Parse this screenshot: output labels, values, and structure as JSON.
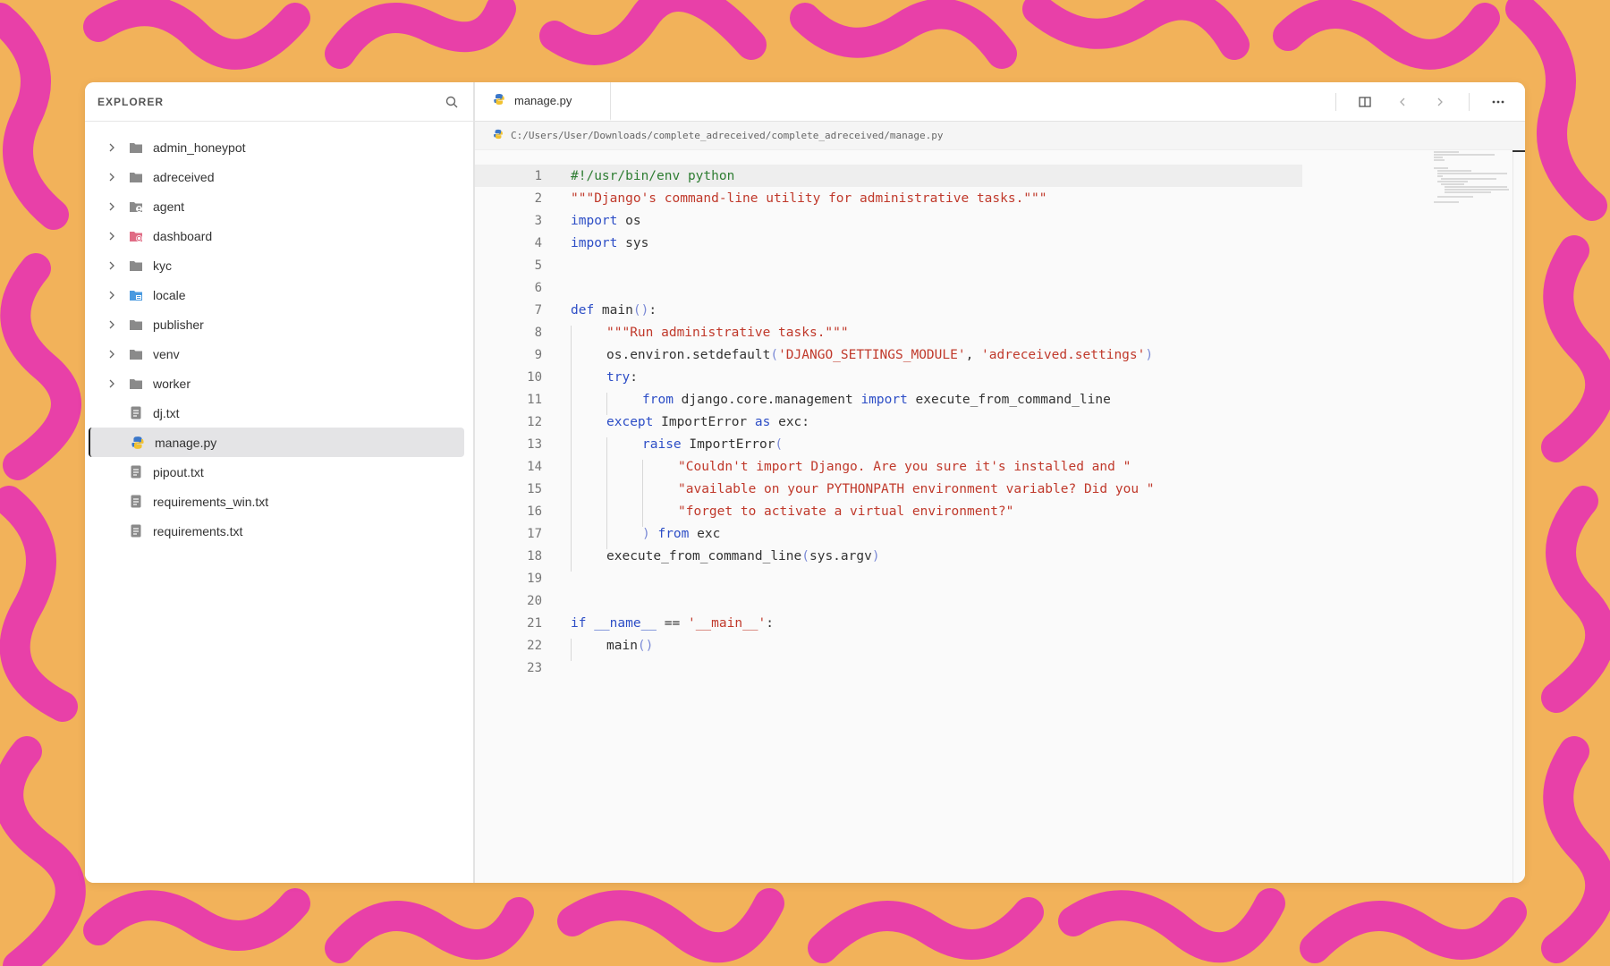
{
  "colors": {
    "background": "#f2b25a",
    "pattern": "#e840a8",
    "keyword": "#2d4ec6",
    "string": "#c0392b",
    "comment": "#2e7d32"
  },
  "sidebar": {
    "title": "EXPLORER",
    "search_icon": "search-icon",
    "items": [
      {
        "label": "admin_honeypot",
        "type": "folder",
        "icon": "folder-icon"
      },
      {
        "label": "adreceived",
        "type": "folder",
        "icon": "folder-icon"
      },
      {
        "label": "agent",
        "type": "folder",
        "icon": "folder-agent-icon"
      },
      {
        "label": "dashboard",
        "type": "folder",
        "icon": "folder-dashboard-icon"
      },
      {
        "label": "kyc",
        "type": "folder",
        "icon": "folder-icon"
      },
      {
        "label": "locale",
        "type": "folder",
        "icon": "folder-locale-icon"
      },
      {
        "label": "publisher",
        "type": "folder",
        "icon": "folder-icon"
      },
      {
        "label": "venv",
        "type": "folder",
        "icon": "folder-icon"
      },
      {
        "label": "worker",
        "type": "folder",
        "icon": "folder-icon"
      },
      {
        "label": "dj.txt",
        "type": "file",
        "icon": "text-file-icon"
      },
      {
        "label": "manage.py",
        "type": "file",
        "icon": "python-file-icon",
        "selected": true
      },
      {
        "label": "pipout.txt",
        "type": "file",
        "icon": "text-file-icon"
      },
      {
        "label": "requirements_win.txt",
        "type": "file",
        "icon": "text-file-icon"
      },
      {
        "label": "requirements.txt",
        "type": "file",
        "icon": "text-file-icon"
      }
    ]
  },
  "editor": {
    "tab_label": "manage.py",
    "breadcrumb": "C:/Users/User/Downloads/complete_adreceived/complete_adreceived/manage.py",
    "current_line": 1,
    "lines": [
      {
        "n": "1",
        "indent": 0,
        "tokens": [
          {
            "t": "#!/usr/bin/env python",
            "c": "cmt"
          }
        ]
      },
      {
        "n": "2",
        "indent": 0,
        "tokens": [
          {
            "t": "\"\"\"Django's command-line utility for administrative tasks.\"\"\"",
            "c": "str"
          }
        ]
      },
      {
        "n": "3",
        "indent": 0,
        "tokens": [
          {
            "t": "import",
            "c": "kw"
          },
          {
            "t": " os",
            "c": ""
          }
        ]
      },
      {
        "n": "4",
        "indent": 0,
        "tokens": [
          {
            "t": "import",
            "c": "kw"
          },
          {
            "t": " sys",
            "c": ""
          }
        ]
      },
      {
        "n": "5",
        "indent": 0,
        "tokens": []
      },
      {
        "n": "6",
        "indent": 0,
        "tokens": []
      },
      {
        "n": "7",
        "indent": 0,
        "tokens": [
          {
            "t": "def",
            "c": "kw"
          },
          {
            "t": " main",
            "c": ""
          },
          {
            "t": "()",
            "c": "pun"
          },
          {
            "t": ":",
            "c": ""
          }
        ]
      },
      {
        "n": "8",
        "indent": 1,
        "tokens": [
          {
            "t": "\"\"\"Run administrative tasks.\"\"\"",
            "c": "str"
          }
        ]
      },
      {
        "n": "9",
        "indent": 1,
        "tokens": [
          {
            "t": "os.environ.setdefault",
            "c": ""
          },
          {
            "t": "(",
            "c": "pun"
          },
          {
            "t": "'DJANGO_SETTINGS_MODULE'",
            "c": "str"
          },
          {
            "t": ", ",
            "c": ""
          },
          {
            "t": "'adreceived.settings'",
            "c": "str"
          },
          {
            "t": ")",
            "c": "pun"
          }
        ]
      },
      {
        "n": "10",
        "indent": 1,
        "tokens": [
          {
            "t": "try",
            "c": "kw"
          },
          {
            "t": ":",
            "c": ""
          }
        ]
      },
      {
        "n": "11",
        "indent": 2,
        "tokens": [
          {
            "t": "from",
            "c": "kw"
          },
          {
            "t": " django.core.management ",
            "c": ""
          },
          {
            "t": "import",
            "c": "kw"
          },
          {
            "t": " execute_from_command_line",
            "c": ""
          }
        ]
      },
      {
        "n": "12",
        "indent": 1,
        "tokens": [
          {
            "t": "except",
            "c": "kw"
          },
          {
            "t": " ImportError ",
            "c": ""
          },
          {
            "t": "as",
            "c": "kw"
          },
          {
            "t": " exc:",
            "c": ""
          }
        ]
      },
      {
        "n": "13",
        "indent": 2,
        "tokens": [
          {
            "t": "raise",
            "c": "kw"
          },
          {
            "t": " ImportError",
            "c": ""
          },
          {
            "t": "(",
            "c": "pun"
          }
        ]
      },
      {
        "n": "14",
        "indent": 3,
        "tokens": [
          {
            "t": "\"Couldn't import Django. Are you sure it's installed and \"",
            "c": "str"
          }
        ]
      },
      {
        "n": "15",
        "indent": 3,
        "tokens": [
          {
            "t": "\"available on your PYTHONPATH environment variable? Did you \"",
            "c": "str"
          }
        ]
      },
      {
        "n": "16",
        "indent": 3,
        "tokens": [
          {
            "t": "\"forget to activate a virtual environment?\"",
            "c": "str"
          }
        ]
      },
      {
        "n": "17",
        "indent": 2,
        "tokens": [
          {
            "t": ")",
            "c": "pun"
          },
          {
            "t": " ",
            "c": ""
          },
          {
            "t": "from",
            "c": "kw"
          },
          {
            "t": " exc",
            "c": ""
          }
        ]
      },
      {
        "n": "18",
        "indent": 1,
        "tokens": [
          {
            "t": "execute_from_command_line",
            "c": ""
          },
          {
            "t": "(",
            "c": "pun"
          },
          {
            "t": "sys.argv",
            "c": ""
          },
          {
            "t": ")",
            "c": "pun"
          }
        ]
      },
      {
        "n": "19",
        "indent": 0,
        "tokens": []
      },
      {
        "n": "20",
        "indent": 0,
        "tokens": []
      },
      {
        "n": "21",
        "indent": 0,
        "tokens": [
          {
            "t": "if",
            "c": "kw"
          },
          {
            "t": " __name__",
            "c": "kw"
          },
          {
            "t": " == ",
            "c": ""
          },
          {
            "t": "'__main__'",
            "c": "str"
          },
          {
            "t": ":",
            "c": ""
          }
        ]
      },
      {
        "n": "22",
        "indent": 1,
        "tokens": [
          {
            "t": "main",
            "c": ""
          },
          {
            "t": "()",
            "c": "pun"
          }
        ]
      },
      {
        "n": "23",
        "indent": 0,
        "tokens": []
      }
    ],
    "actions": {
      "split_icon": "split-editor-icon",
      "back_icon": "chevron-left-icon",
      "forward_icon": "chevron-right-icon",
      "more_icon": "more-icon"
    }
  }
}
